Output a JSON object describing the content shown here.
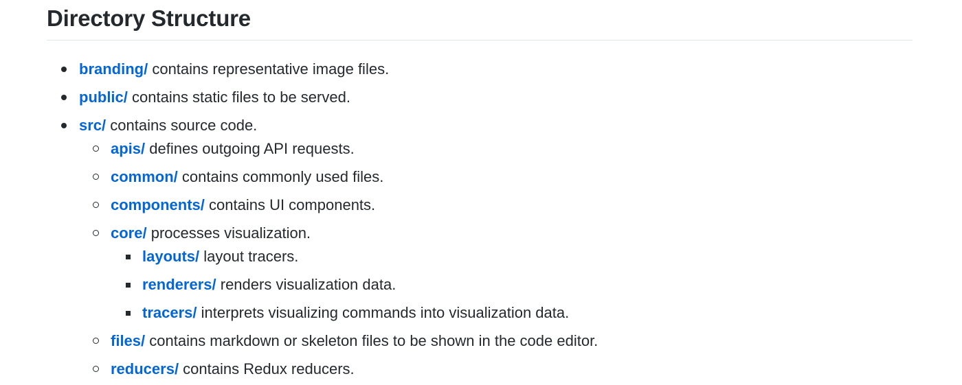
{
  "section": {
    "title": "Directory Structure"
  },
  "items": [
    {
      "link": "branding/",
      "desc": " contains representative image files."
    },
    {
      "link": "public/",
      "desc": " contains static files to be served."
    },
    {
      "link": "src/",
      "desc": " contains source code."
    },
    {
      "link": "apis/",
      "desc": " defines outgoing API requests."
    },
    {
      "link": "common/",
      "desc": " contains commonly used files."
    },
    {
      "link": "components/",
      "desc": " contains UI components."
    },
    {
      "link": "core/",
      "desc": " processes visualization."
    },
    {
      "link": "layouts/",
      "desc": " layout tracers."
    },
    {
      "link": "renderers/",
      "desc": " renders visualization data."
    },
    {
      "link": "tracers/",
      "desc": " interprets visualizing commands into visualization data."
    },
    {
      "link": "files/",
      "desc": " contains markdown or skeleton files to be shown in the code editor."
    },
    {
      "link": "reducers/",
      "desc": " contains Redux reducers."
    }
  ],
  "colors": {
    "link": "#0366d6",
    "text": "#24292e",
    "rule": "#e1e4e8"
  }
}
